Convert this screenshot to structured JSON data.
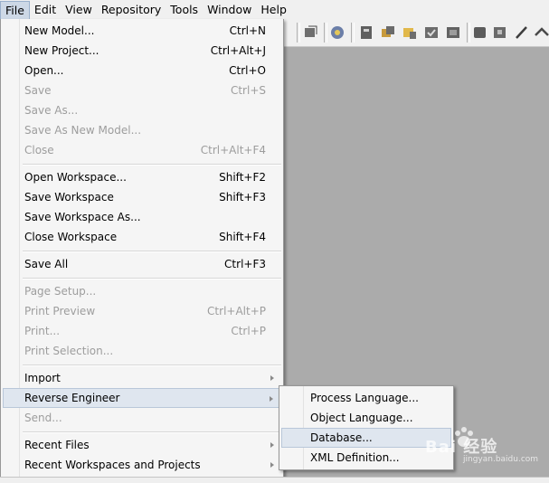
{
  "menubar": {
    "items": [
      "File",
      "Edit",
      "View",
      "Repository",
      "Tools",
      "Window",
      "Help"
    ]
  },
  "file_menu": {
    "items": [
      {
        "label": "New Model...",
        "shortcut": "Ctrl+N",
        "enabled": true
      },
      {
        "label": "New Project...",
        "shortcut": "Ctrl+Alt+J",
        "enabled": true
      },
      {
        "label": "Open...",
        "shortcut": "Ctrl+O",
        "enabled": true
      },
      {
        "label": "Save",
        "shortcut": "Ctrl+S",
        "enabled": false
      },
      {
        "label": "Save As...",
        "shortcut": "",
        "enabled": false
      },
      {
        "label": "Save As New Model...",
        "shortcut": "",
        "enabled": false
      },
      {
        "label": "Close",
        "shortcut": "Ctrl+Alt+F4",
        "enabled": false
      },
      {
        "label": "Open Workspace...",
        "shortcut": "Shift+F2",
        "enabled": true
      },
      {
        "label": "Save Workspace",
        "shortcut": "Shift+F3",
        "enabled": true
      },
      {
        "label": "Save Workspace As...",
        "shortcut": "",
        "enabled": true
      },
      {
        "label": "Close Workspace",
        "shortcut": "Shift+F4",
        "enabled": true
      },
      {
        "label": "Save All",
        "shortcut": "Ctrl+F3",
        "enabled": true
      },
      {
        "label": "Page Setup...",
        "shortcut": "",
        "enabled": false
      },
      {
        "label": "Print Preview",
        "shortcut": "Ctrl+Alt+P",
        "enabled": false
      },
      {
        "label": "Print...",
        "shortcut": "Ctrl+P",
        "enabled": false
      },
      {
        "label": "Print Selection...",
        "shortcut": "",
        "enabled": false
      },
      {
        "label": "Import",
        "shortcut": "",
        "enabled": true,
        "submenu": true
      },
      {
        "label": "Reverse Engineer",
        "shortcut": "",
        "enabled": true,
        "submenu": true,
        "highlighted": true
      },
      {
        "label": "Send...",
        "shortcut": "",
        "enabled": false
      },
      {
        "label": "Recent Files",
        "shortcut": "",
        "enabled": true,
        "submenu": true
      },
      {
        "label": "Recent Workspaces and Projects",
        "shortcut": "",
        "enabled": true,
        "submenu": true
      }
    ]
  },
  "reverse_engineer_submenu": {
    "items": [
      {
        "label": "Process Language..."
      },
      {
        "label": "Object Language..."
      },
      {
        "label": "Database...",
        "highlighted": true
      },
      {
        "label": "XML Definition..."
      }
    ]
  },
  "toolbar": {
    "icons": [
      "model-icon",
      "browser-icon",
      "properties-icon",
      "compare-icon",
      "merge-icon",
      "check-model-icon",
      "generate-icon",
      "undo-icon",
      "redo-icon",
      "pencil-icon",
      "arrow-icon"
    ]
  },
  "watermark": {
    "text": "Bai 经验",
    "url": "jingyan.baidu.com"
  }
}
